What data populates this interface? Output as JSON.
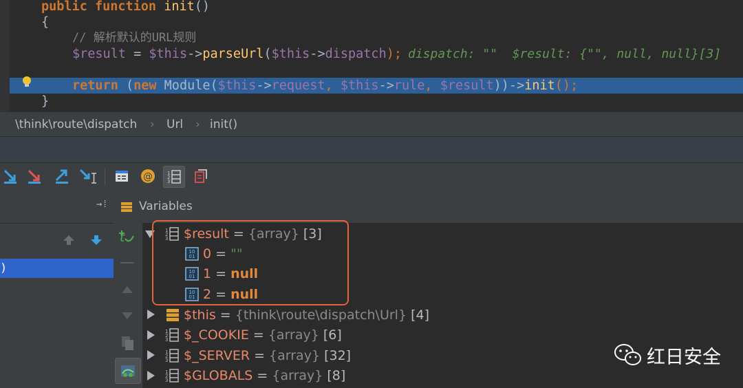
{
  "editor": {
    "lines": {
      "l1_kw": "public function",
      "l1_fn": "init",
      "l1_rest": "()",
      "l2": "{",
      "l3_comment": "// 解析默认的URL规则",
      "l4_var1": "$result",
      "l4_eq": " = ",
      "l4_var2": "$this",
      "l4_arrow1": "->",
      "l4_fn": "parseUrl",
      "l4_paren": "(",
      "l4_var3": "$this",
      "l4_arrow2": "->",
      "l4_prop": "dispatch",
      "l4_end": ");",
      "l4_inline": "dispatch: \"\"  $result: {\"\", null, null}[3]",
      "l6_kw": "return",
      "l6_p1": " (",
      "l6_new": "new",
      "l6_mod": " Module(",
      "l6_v1": "$this",
      "l6_a1": "->",
      "l6_p_req": "request",
      "l6_c1": ", ",
      "l6_v2": "$this",
      "l6_a2": "->",
      "l6_p_rule": "rule",
      "l6_c2": ", ",
      "l6_v3": "$result",
      "l6_close": "))->",
      "l6_fn": "init",
      "l6_tail": "();",
      "l7": "}"
    }
  },
  "breadcrumb": {
    "items": [
      "\\think\\route\\dispatch",
      "Url",
      "init()"
    ],
    "separator": "›"
  },
  "variables_panel": {
    "title": "Variables"
  },
  "frames": {
    "selected_label": ")"
  },
  "variables": [
    {
      "name": "$result",
      "eq": " = ",
      "type": "{array}",
      "count": " [3]",
      "expanded": true,
      "children": [
        {
          "name": "0",
          "eq": " = ",
          "value": "\"\""
        },
        {
          "name": "1",
          "eq": " = ",
          "value": "null"
        },
        {
          "name": "2",
          "eq": " = ",
          "value": "null"
        }
      ]
    },
    {
      "name": "$this",
      "eq": " = ",
      "type": "{think\\route\\dispatch\\Url}",
      "count": " [4]"
    },
    {
      "name": "$_COOKIE",
      "eq": " = ",
      "type": "{array}",
      "count": " [6]"
    },
    {
      "name": "$_SERVER",
      "eq": " = ",
      "type": "{array}",
      "count": " [32]"
    },
    {
      "name": "$GLOBALS",
      "eq": " = ",
      "type": "{array}",
      "count": " [8]"
    }
  ],
  "watermark": {
    "text": "红日安全"
  },
  "colors": {
    "highlight_line": "#2d6099",
    "annotation_box": "#e4643e",
    "selected_frame": "#2f65ca"
  }
}
